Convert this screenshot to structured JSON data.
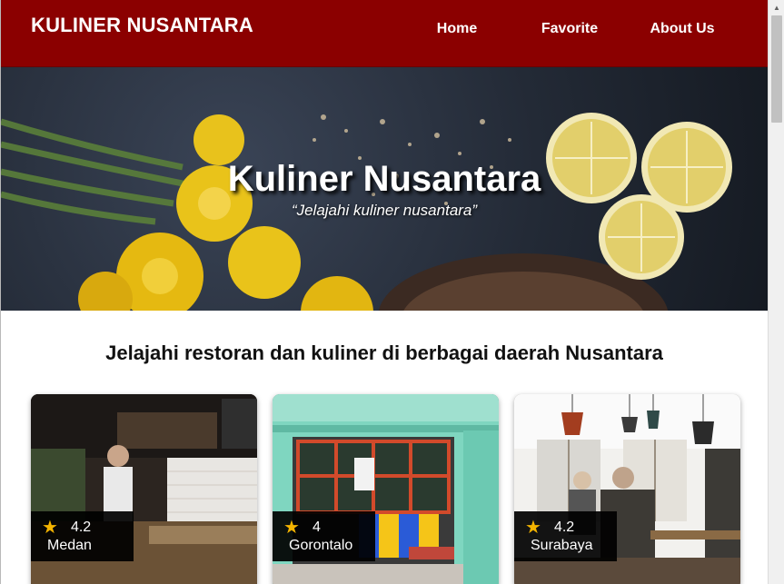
{
  "header": {
    "brand": "KULINER NUSANTARA",
    "nav": [
      "Home",
      "Favorite",
      "About Us"
    ]
  },
  "hero": {
    "title": "Kuliner Nusantara",
    "tagline": "“Jelajahi kuliner nusantara”"
  },
  "main": {
    "heading": "Jelajahi restoran dan kuliner di berbagai daerah Nusantara",
    "restaurants": [
      {
        "rating": "4.2",
        "city": "Medan"
      },
      {
        "rating": "4",
        "city": "Gorontalo"
      },
      {
        "rating": "4.2",
        "city": "Surabaya"
      }
    ]
  },
  "colors": {
    "app_bar": "#8b0000",
    "star": "#f4b400"
  },
  "icons": [
    "star-icon"
  ]
}
